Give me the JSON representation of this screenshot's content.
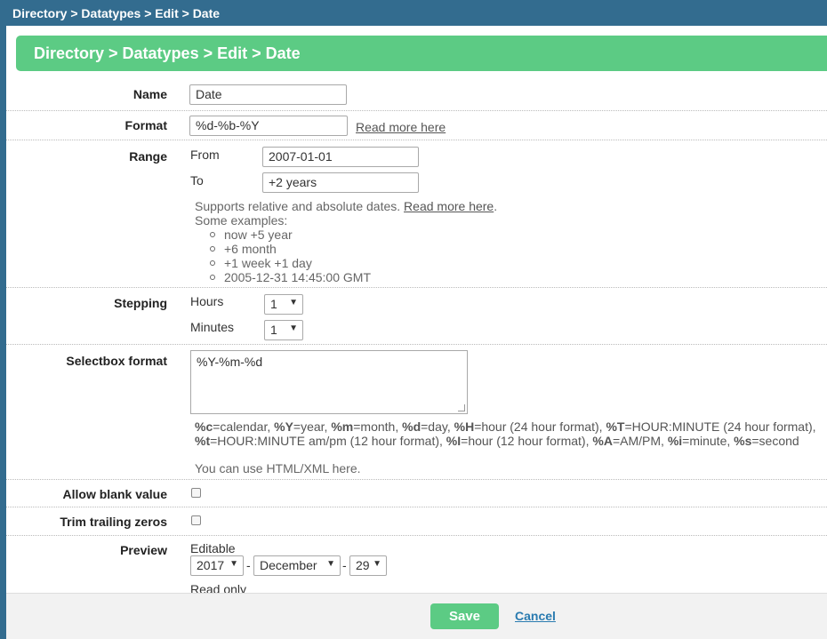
{
  "window": {
    "title": "Directory > Datatypes > Edit > Date"
  },
  "panel": {
    "title": "Directory > Datatypes > Edit > Date"
  },
  "name": {
    "label": "Name",
    "value": "Date"
  },
  "format": {
    "label": "Format",
    "value": "%d-%b-%Y",
    "read_more": "Read more here"
  },
  "range": {
    "label": "Range",
    "from_label": "From",
    "from_value": "2007-01-01",
    "to_label": "To",
    "to_value": "+2 years",
    "help_prefix": "Supports relative and absolute dates. ",
    "help_link": "Read more here",
    "help_suffix": ".",
    "examples_title": "Some examples:",
    "examples": [
      "now +5 year",
      "+6 month",
      "+1 week +1 day",
      "2005-12-31 14:45:00 GMT"
    ]
  },
  "stepping": {
    "label": "Stepping",
    "hours_label": "Hours",
    "hours_value": "1",
    "minutes_label": "Minutes",
    "minutes_value": "1"
  },
  "selectbox_format": {
    "label": "Selectbox format",
    "value": "%Y-%m-%d",
    "help_line1": [
      {
        "code": "%c",
        "text": "=calendar, "
      },
      {
        "code": "%Y",
        "text": "=year, "
      },
      {
        "code": "%m",
        "text": "=month, "
      },
      {
        "code": "%d",
        "text": "=day, "
      },
      {
        "code": "%H",
        "text": "=hour (24 hour format), "
      },
      {
        "code": "%T",
        "text": "=HOUR:MINUTE (24 hour format),"
      }
    ],
    "help_line2": [
      {
        "code": "%t",
        "text": "=HOUR:MINUTE am/pm (12 hour format), "
      },
      {
        "code": "%I",
        "text": "=hour (12 hour format), "
      },
      {
        "code": "%A",
        "text": "=AM/PM, "
      },
      {
        "code": "%i",
        "text": "=minute, "
      },
      {
        "code": "%s",
        "text": "=second"
      }
    ],
    "html_note": "You can use HTML/XML here."
  },
  "allow_blank": {
    "label": "Allow blank value",
    "checked": false
  },
  "trim_zeros": {
    "label": "Trim trailing zeros",
    "checked": false
  },
  "preview": {
    "label": "Preview",
    "editable_label": "Editable",
    "year": "2017",
    "month": "December",
    "day": "29",
    "separator": "-",
    "readonly_label": "Read only"
  },
  "footer": {
    "save_label": "Save",
    "cancel_label": "Cancel"
  },
  "colors": {
    "accent": "#5ccb84",
    "frame": "#336c8f",
    "link": "#2a7bb0"
  }
}
